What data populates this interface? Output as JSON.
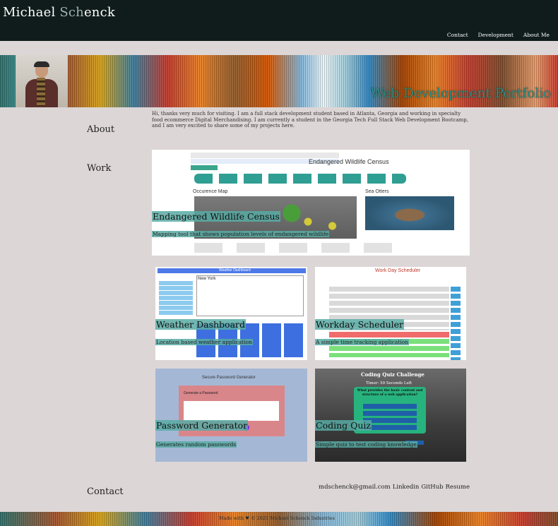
{
  "header": {
    "brand_first": "Michael ",
    "brand_accent": "Sch",
    "brand_rest": "enck",
    "nav": [
      "Contact",
      "Development",
      "About Me"
    ]
  },
  "hero": {
    "title": "Web Development Portfolio"
  },
  "about": {
    "label": "About",
    "text": "Hi, thanks very much for visiting. I am a full stack development student based in Atlanta, Georgia and working in specialty food ecommerce Digital Merchandising. I am currently a student in the Georgia Tech Full Stack Web Development Bootcamp, and I am very excited to share some of my projects here."
  },
  "work": {
    "label": "Work",
    "projects": [
      {
        "title": "Endangered Wildlife Census",
        "desc": "Mapping tool that shows population levels of endangered wildlife",
        "shot_title": "Endangered Wildlife Census",
        "shot_sub1": "Occurence Map",
        "shot_sub2": "Sea Otters"
      },
      {
        "title": "Weather Dashboard",
        "desc": "Location based weather application",
        "shot_title": "Weather Dashboard",
        "shot_city": "New York"
      },
      {
        "title": "Workday Scheduler",
        "desc": "A simple time tracking application",
        "shot_title": "Work Day Scheduler"
      },
      {
        "title": "Password Generator",
        "desc": "Generates random passwords",
        "shot_title": "Secure Password Generator",
        "shot_sub": "Generate a Password"
      },
      {
        "title": "Coding Quiz",
        "desc": "Simple quiz to test coding knowledge",
        "shot_title": "Coding Quiz Challenge",
        "shot_timer": "Timer: 59 Seconds Left",
        "shot_question": "What provides the basic content and structure of a web application?"
      }
    ]
  },
  "contact": {
    "label": "Contact",
    "links": [
      "mdschenck@gmail.com",
      "Linkedin",
      "GitHub",
      "Resume"
    ]
  },
  "footer": {
    "text": "Made with ♥ © 2021 Michael Schenck Industries"
  },
  "colors": {
    "header_bg": "#0f1c1b",
    "page_bg": "#ddd6d6",
    "accent": "#58aaa3",
    "hero_title": "#2a8a7e"
  }
}
